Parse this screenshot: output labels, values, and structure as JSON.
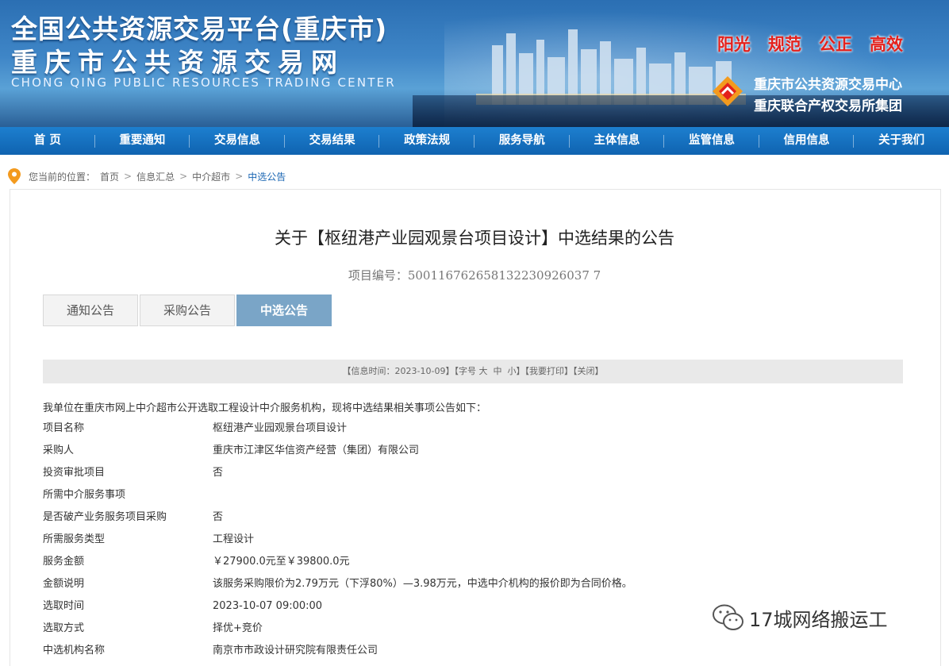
{
  "header": {
    "title_line1": "全国公共资源交易平台(重庆市)",
    "title_line2": "重庆市公共资源交易网",
    "title_en": "CHONG QING PUBLIC RESOURCES TRADING CENTER",
    "slogans": [
      "阳光",
      "规范",
      "公正",
      "高效"
    ],
    "org_line1": "重庆市公共资源交易中心",
    "org_line2": "重庆联合产权交易所集团",
    "slogan_color": "#e4211c"
  },
  "nav": [
    "首 页",
    "重要通知",
    "交易信息",
    "交易结果",
    "政策法规",
    "服务导航",
    "主体信息",
    "监管信息",
    "信用信息",
    "关于我们"
  ],
  "breadcrumb": {
    "label": "您当前的位置：",
    "items": [
      "首页",
      "信息汇总",
      "中介超市",
      "中选公告"
    ]
  },
  "notice": {
    "title": "关于【枢纽港产业园观景台项目设计】中选结果的公告",
    "project_no": "项目编号：500116762658132230926037 7",
    "tabs": [
      "通知公告",
      "采购公告",
      "中选公告"
    ],
    "active_tab": 2,
    "infobar": {
      "time": "【信息时间：2023-10-09】",
      "font_prefix": "【字号 ",
      "font_large": "大",
      "font_mid": "中",
      "font_small": "小",
      "font_suffix": "】",
      "print": "【我要打印】",
      "close": "【关闭】"
    },
    "intro": "我单位在重庆市网上中介超市公开选取工程设计中介服务机构，现将中选结果相关事项公告如下：",
    "fields": [
      {
        "key": "项目名称",
        "value": "枢纽港产业园观景台项目设计"
      },
      {
        "key": "采购人",
        "value": "重庆市江津区华信资产经营（集团）有限公司"
      },
      {
        "key": "投资审批项目",
        "value": "否"
      },
      {
        "key": "所需中介服务事项",
        "value": ""
      },
      {
        "key": "是否破产业务服务项目采购",
        "value": "否"
      },
      {
        "key": "所需服务类型",
        "value": "工程设计"
      },
      {
        "key": "服务金额",
        "value": "￥27900.0元至￥39800.0元"
      },
      {
        "key": "金额说明",
        "value": "该服务采购限价为2.79万元（下浮80%）—3.98万元，中选中介机构的报价即为合同价格。"
      },
      {
        "key": "选取时间",
        "value": "2023-10-07 09:00:00"
      },
      {
        "key": "选取方式",
        "value": "择优+竞价"
      },
      {
        "key": "中选机构名称",
        "value": "南京市市政设计研究院有限责任公司"
      }
    ]
  },
  "watermark": {
    "icon": "wechat-icon",
    "text": "17城网络搬运工"
  },
  "colors": {
    "nav_bg": "#1d7fcf",
    "tab_active": "#7aa5c7",
    "crumb_current": "#1a66b3"
  }
}
